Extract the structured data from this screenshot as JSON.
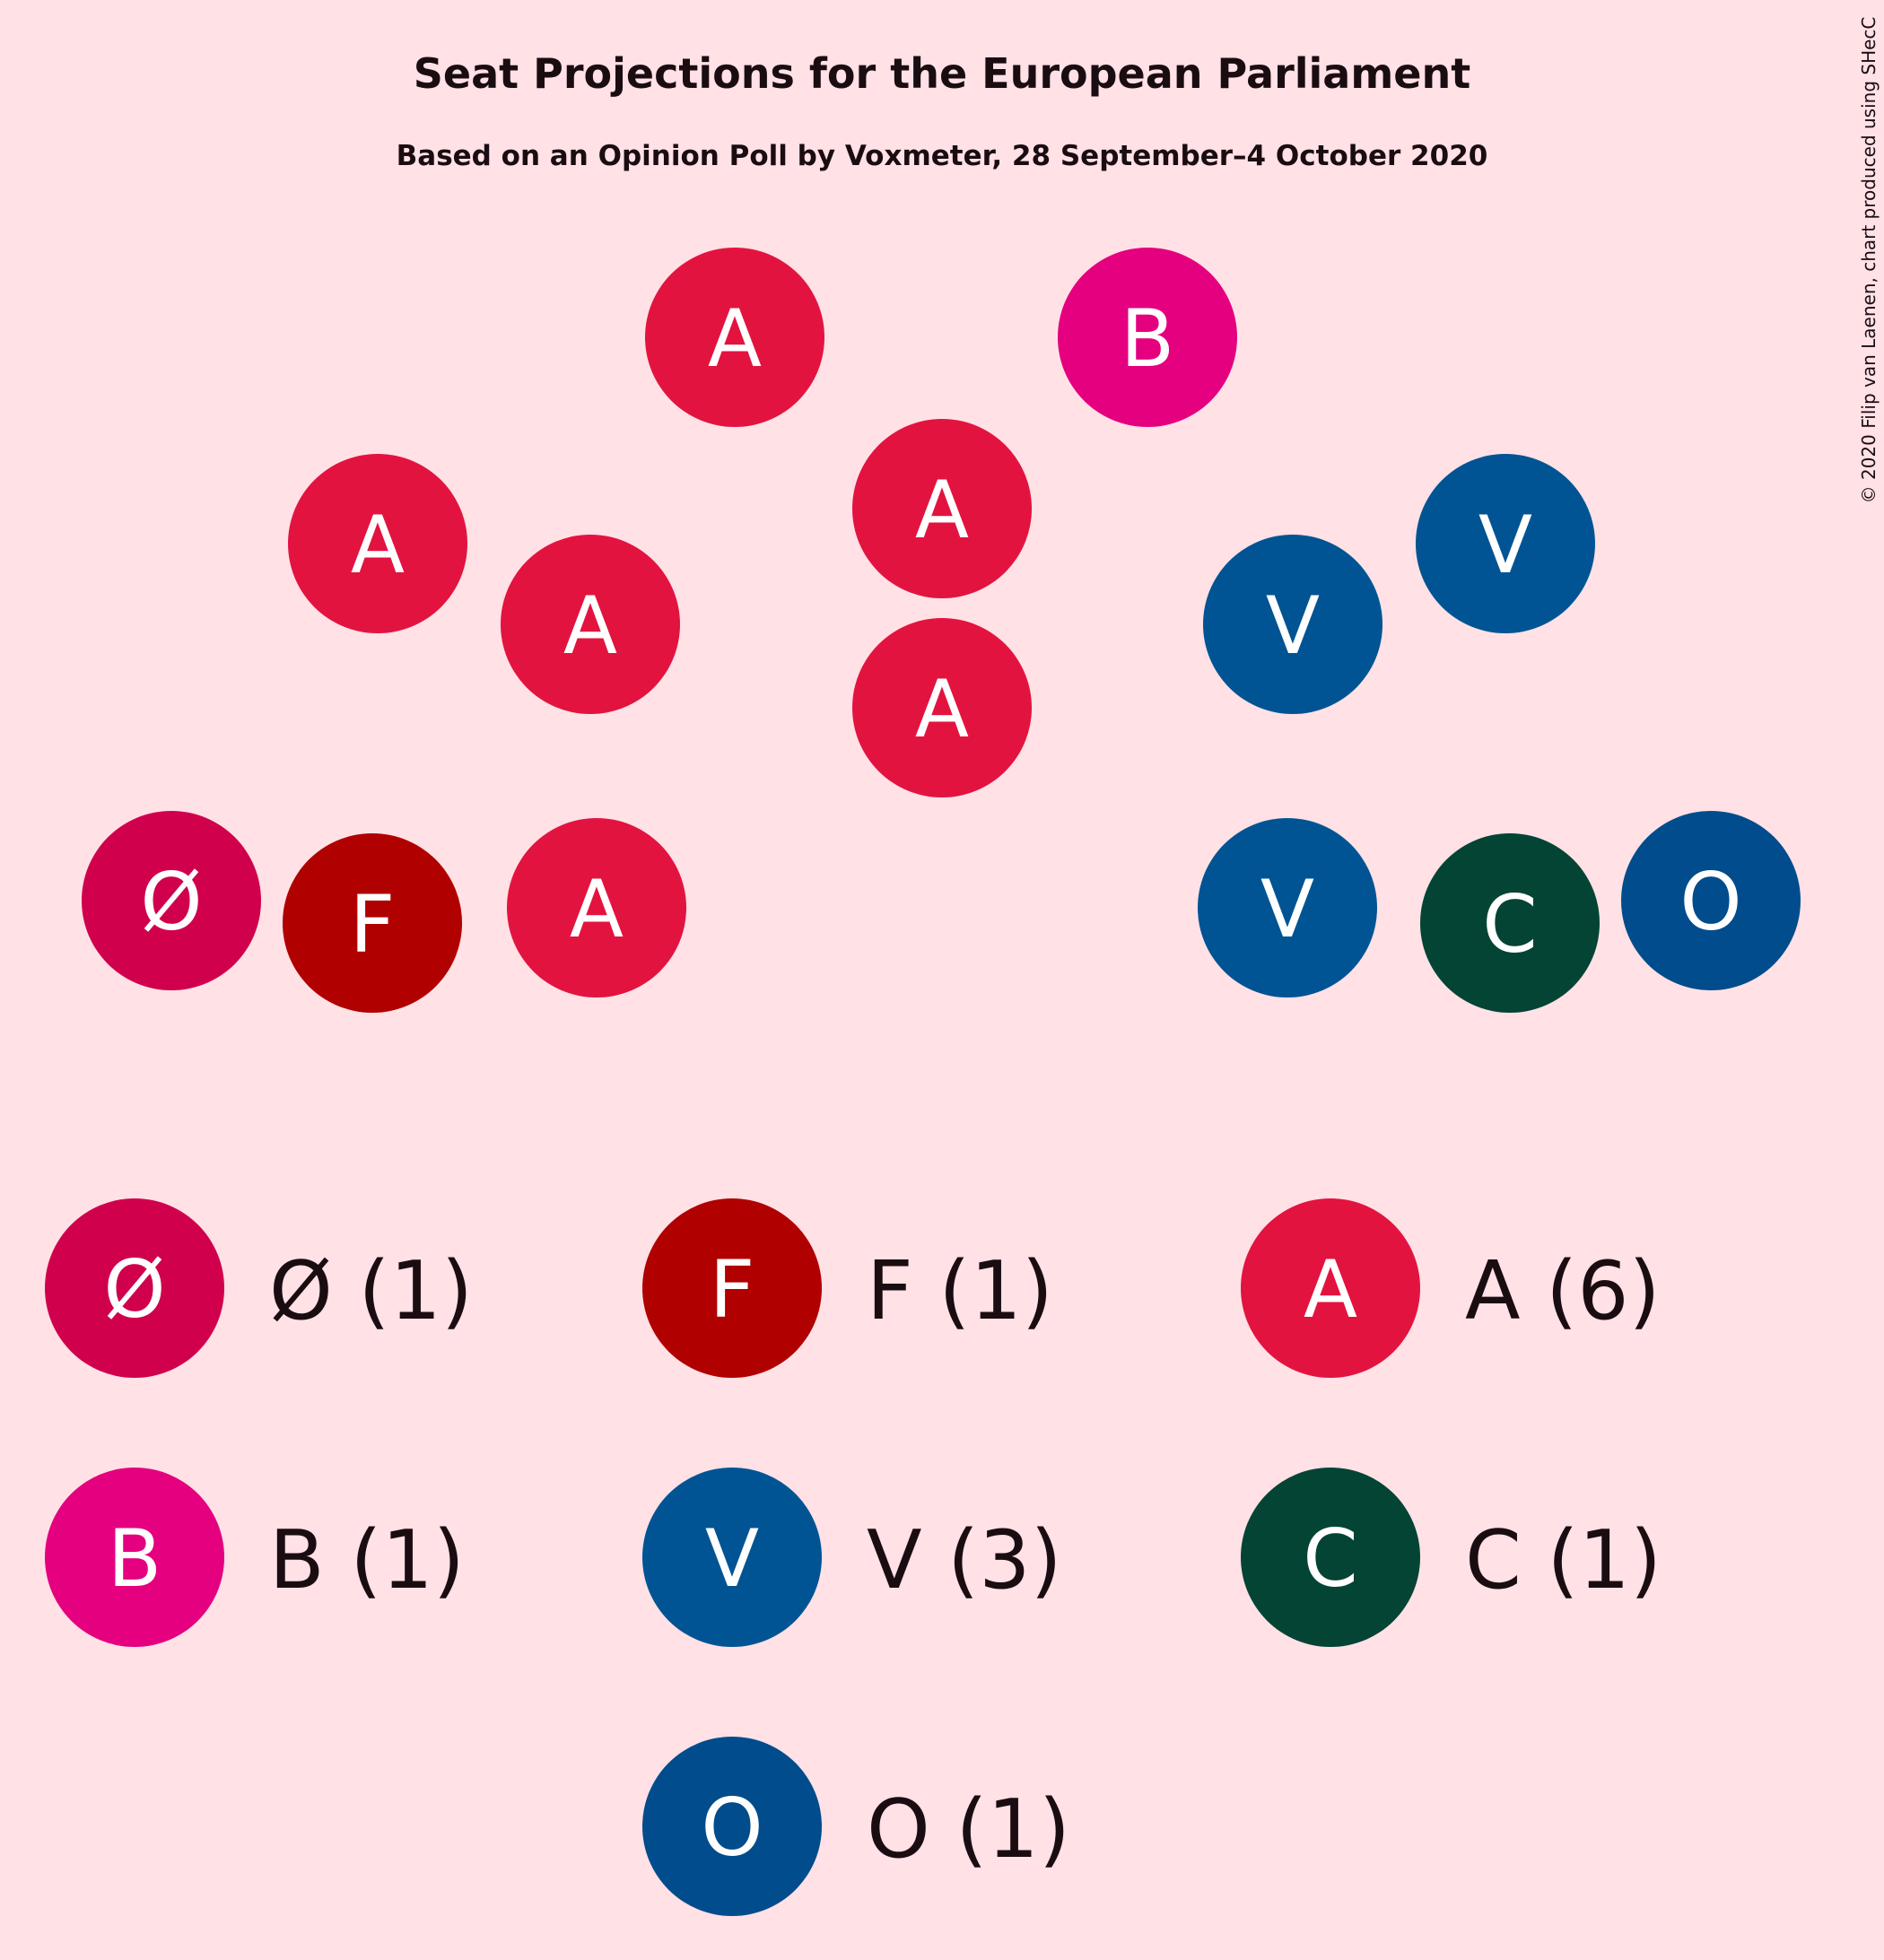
{
  "chart_data": {
    "type": "seat-projection",
    "title": "Seat Projections for the European Parliament",
    "subtitle": "Based on an Opinion Poll by Voxmeter, 28 September–4 October 2020",
    "copyright": "© 2020 Filip van Laenen, chart produced using SHecC",
    "parties": [
      {
        "code": "Ø",
        "seats": 1,
        "color": "#d0004d",
        "legend": "Ø (1)"
      },
      {
        "code": "F",
        "seats": 1,
        "color": "#b00000",
        "legend": "F (1)"
      },
      {
        "code": "A",
        "seats": 6,
        "color": "#e3133f",
        "legend": "A (6)"
      },
      {
        "code": "B",
        "seats": 1,
        "color": "#e4007f",
        "legend": "B (1)"
      },
      {
        "code": "V",
        "seats": 3,
        "color": "#005494",
        "legend": "V (3)"
      },
      {
        "code": "C",
        "seats": 1,
        "color": "#034435",
        "legend": "C (1)"
      },
      {
        "code": "O",
        "seats": 1,
        "color": "#004c8c",
        "legend": "O (1)"
      }
    ],
    "seats": [
      "A",
      "B",
      "A",
      "A",
      "A",
      "V",
      "A",
      "V",
      "Ø",
      "F",
      "A",
      "V",
      "C",
      "O"
    ]
  }
}
